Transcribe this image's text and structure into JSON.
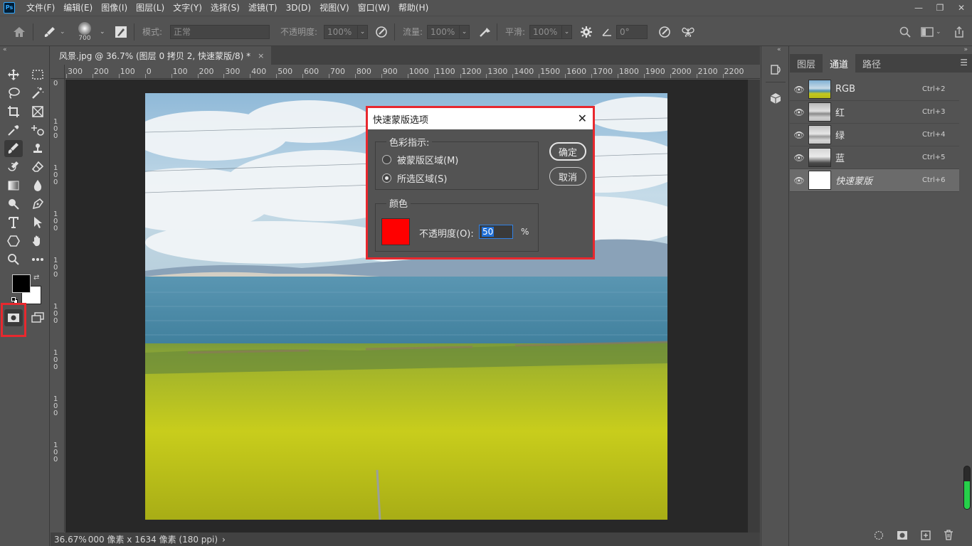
{
  "app": {
    "logo": "Ps"
  },
  "menu": [
    "文件(F)",
    "编辑(E)",
    "图像(I)",
    "图层(L)",
    "文字(Y)",
    "选择(S)",
    "滤镜(T)",
    "3D(D)",
    "视图(V)",
    "窗口(W)",
    "帮助(H)"
  ],
  "window_controls": {
    "minimize": "—",
    "restore": "❐",
    "close": "✕"
  },
  "options": {
    "brush_size": "700",
    "mode_label": "模式:",
    "mode_value": "正常",
    "opacity_label": "不透明度:",
    "opacity_value": "100%",
    "flow_label": "流量:",
    "flow_value": "100%",
    "smoothing_label": "平滑:",
    "smoothing_value": "100%",
    "angle_value": "0°"
  },
  "document": {
    "tab_title": "风景.jpg @ 36.7% (图层 0 拷贝 2, 快速蒙版/8) *",
    "tab_close": "×",
    "ruler_top": [
      "300",
      "200",
      "100",
      "0",
      "100",
      "200",
      "300",
      "400",
      "500",
      "600",
      "700",
      "800",
      "900",
      "1000",
      "1100",
      "1200",
      "1300",
      "1400",
      "1500",
      "1600",
      "1700",
      "1800",
      "1900",
      "2000",
      "2100",
      "2200"
    ],
    "ruler_left": [
      "0",
      "1 0 0",
      "1 0 0",
      "1 0 0",
      "1 0 0",
      "1 0 0",
      "1 0 0",
      "1 0 0",
      "1 0 0"
    ],
    "status_zoom": "36.67%",
    "status_info": "000 像素 x 1634 像素 (180 ppi)",
    "status_arrow": "›"
  },
  "panel": {
    "tabs": [
      "图层",
      "通道",
      "路径"
    ],
    "active_tab": "通道",
    "channels": [
      {
        "name": "RGB",
        "shortcut": "Ctrl+2",
        "thumb": "rgb"
      },
      {
        "name": "红",
        "shortcut": "Ctrl+3",
        "thumb": "gray-light"
      },
      {
        "name": "绿",
        "shortcut": "Ctrl+4",
        "thumb": "gray-mid"
      },
      {
        "name": "蓝",
        "shortcut": "Ctrl+5",
        "thumb": "gray-dark"
      },
      {
        "name": "快速蒙版",
        "shortcut": "Ctrl+6",
        "thumb": "white"
      }
    ],
    "scroll_level": 0.65,
    "bottom_icons": [
      "dotted-circle-icon",
      "mask-icon",
      "new-channel-icon",
      "trash-icon"
    ]
  },
  "dialog": {
    "title": "快速蒙版选项",
    "close": "✕",
    "color_indicates_label": "色彩指示:",
    "option_masked": "被蒙版区域(M)",
    "option_selected": "所选区域(S)",
    "selected_option": "option_selected",
    "color_group_label": "颜色",
    "opacity_label": "不透明度(O):",
    "opacity_value": "50",
    "opacity_unit": "%",
    "ok": "确定",
    "cancel": "取消",
    "swatch_color": "#ff0000",
    "accent": "#e8282e"
  }
}
